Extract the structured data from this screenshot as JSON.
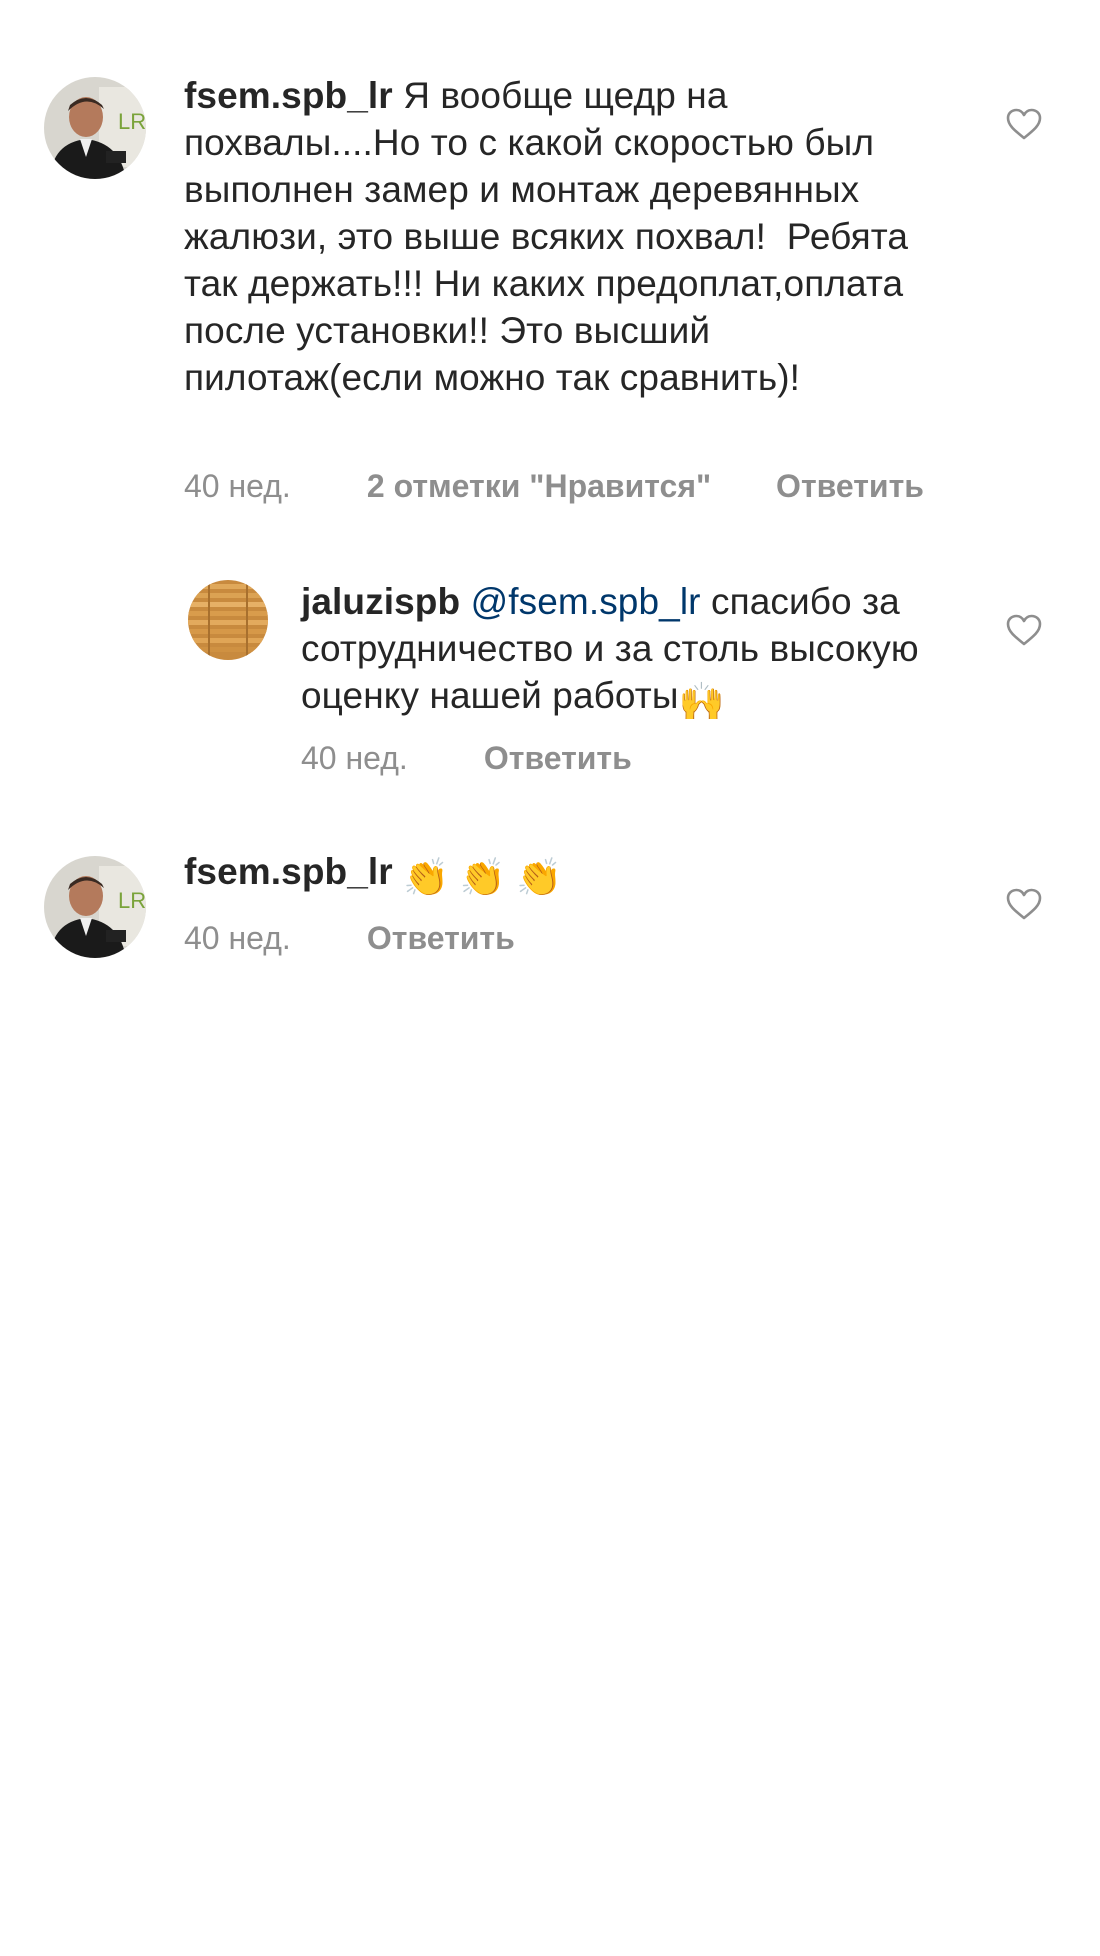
{
  "comments": [
    {
      "username": "fsem.spb_lr",
      "text": "Я вообще щедр на похвалы....Но то с какой скоростью был выполнен замер и монтаж деревянных жалюзи, это выше всяких похвал!  Ребята так держать!!! Ни каких предоплат,оплата после установки!! Это высший пилотаж(если можно так сравнить)!",
      "time": "40 нед.",
      "likes": "2 отметки \"Нравится\"",
      "reply_label": "Ответить",
      "avatar_icon": "user-photo-icon",
      "like_icon": "heart-outline-icon"
    },
    {
      "username": "jaluzispb",
      "mention": "@fsem.spb_lr",
      "text": " спасибо за сотрудничество и за столь высокую оценку нашей работы",
      "emoji": "🙌",
      "time": "40 нед.",
      "reply_label": "Ответить",
      "avatar_icon": "wooden-blinds-icon",
      "like_icon": "heart-outline-icon"
    },
    {
      "username": "fsem.spb_lr",
      "text": "",
      "emoji": "👏 👏 👏",
      "time": "40 нед.",
      "reply_label": "Ответить",
      "avatar_icon": "user-photo-icon",
      "like_icon": "heart-outline-icon"
    }
  ],
  "colors": {
    "text": "#262626",
    "secondary": "#8e8e8e",
    "mention": "#00376b",
    "background": "#ffffff"
  }
}
